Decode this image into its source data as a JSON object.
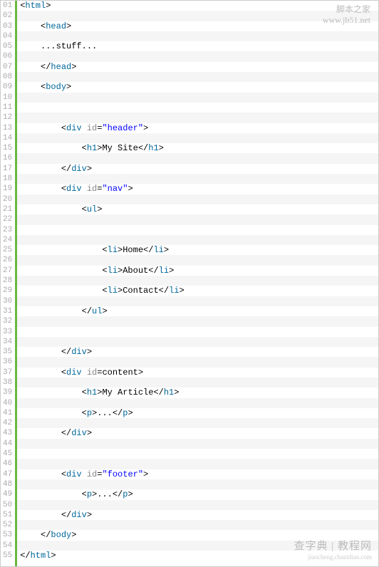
{
  "watermark_top": {
    "line1": "脚本之家",
    "line2": "www.jb51.net"
  },
  "watermark_bottom": {
    "line1": "查字典 | 教程网",
    "line2": "jiaocheng.chazidian.com"
  },
  "lines": [
    {
      "n": "01",
      "indent": 0,
      "type": "tag",
      "open": "<",
      "name": "html",
      "attrs": [],
      "close": ">"
    },
    {
      "n": "02",
      "indent": 0,
      "type": "blank"
    },
    {
      "n": "03",
      "indent": 1,
      "type": "tag",
      "open": "<",
      "name": "head",
      "attrs": [],
      "close": ">"
    },
    {
      "n": "04",
      "indent": 0,
      "type": "blank"
    },
    {
      "n": "05",
      "indent": 1,
      "type": "text",
      "text": "...stuff..."
    },
    {
      "n": "06",
      "indent": 0,
      "type": "blank"
    },
    {
      "n": "07",
      "indent": 1,
      "type": "tag",
      "open": "</",
      "name": "head",
      "attrs": [],
      "close": ">"
    },
    {
      "n": "08",
      "indent": 0,
      "type": "blank"
    },
    {
      "n": "09",
      "indent": 1,
      "type": "tag",
      "open": "<",
      "name": "body",
      "attrs": [],
      "close": ">"
    },
    {
      "n": "10",
      "indent": 0,
      "type": "blank"
    },
    {
      "n": "11",
      "indent": 0,
      "type": "blank"
    },
    {
      "n": "12",
      "indent": 0,
      "type": "blank"
    },
    {
      "n": "13",
      "indent": 2,
      "type": "tag",
      "open": "<",
      "name": "div",
      "attrs": [
        {
          "k": "id",
          "v": "\"header\"",
          "quoted": true
        }
      ],
      "close": ">"
    },
    {
      "n": "14",
      "indent": 0,
      "type": "blank"
    },
    {
      "n": "15",
      "indent": 3,
      "type": "tagtext",
      "open": "<",
      "name": "h1",
      "inner": "My Site",
      "cname": "h1"
    },
    {
      "n": "16",
      "indent": 0,
      "type": "blank"
    },
    {
      "n": "17",
      "indent": 2,
      "type": "tag",
      "open": "</",
      "name": "div",
      "attrs": [],
      "close": ">"
    },
    {
      "n": "18",
      "indent": 0,
      "type": "blank"
    },
    {
      "n": "19",
      "indent": 2,
      "type": "tag",
      "open": "<",
      "name": "div",
      "attrs": [
        {
          "k": "id",
          "v": "\"nav\"",
          "quoted": true
        }
      ],
      "close": ">"
    },
    {
      "n": "20",
      "indent": 0,
      "type": "blank"
    },
    {
      "n": "21",
      "indent": 3,
      "type": "tag",
      "open": "<",
      "name": "ul",
      "attrs": [],
      "close": ">"
    },
    {
      "n": "22",
      "indent": 0,
      "type": "blank"
    },
    {
      "n": "23",
      "indent": 0,
      "type": "blank"
    },
    {
      "n": "24",
      "indent": 0,
      "type": "blank"
    },
    {
      "n": "25",
      "indent": 4,
      "type": "tagtext",
      "open": "<",
      "name": "li",
      "inner": "Home",
      "cname": "li"
    },
    {
      "n": "26",
      "indent": 0,
      "type": "blank"
    },
    {
      "n": "27",
      "indent": 4,
      "type": "tagtext",
      "open": "<",
      "name": "li",
      "inner": "About",
      "cname": "li"
    },
    {
      "n": "28",
      "indent": 0,
      "type": "blank"
    },
    {
      "n": "29",
      "indent": 4,
      "type": "tagtext",
      "open": "<",
      "name": "li",
      "inner": "Contact",
      "cname": "li"
    },
    {
      "n": "30",
      "indent": 0,
      "type": "blank"
    },
    {
      "n": "31",
      "indent": 3,
      "type": "tag",
      "open": "</",
      "name": "ul",
      "attrs": [],
      "close": ">"
    },
    {
      "n": "32",
      "indent": 0,
      "type": "blank"
    },
    {
      "n": "33",
      "indent": 0,
      "type": "blank"
    },
    {
      "n": "34",
      "indent": 0,
      "type": "blank"
    },
    {
      "n": "35",
      "indent": 2,
      "type": "tag",
      "open": "</",
      "name": "div",
      "attrs": [],
      "close": ">"
    },
    {
      "n": "36",
      "indent": 0,
      "type": "blank"
    },
    {
      "n": "37",
      "indent": 2,
      "type": "tag",
      "open": "<",
      "name": "div",
      "attrs": [
        {
          "k": "id",
          "v": "content",
          "quoted": false
        }
      ],
      "close": ">"
    },
    {
      "n": "38",
      "indent": 0,
      "type": "blank"
    },
    {
      "n": "39",
      "indent": 3,
      "type": "tagtext",
      "open": "<",
      "name": "h1",
      "inner": "My Article",
      "cname": "h1"
    },
    {
      "n": "40",
      "indent": 0,
      "type": "blank"
    },
    {
      "n": "41",
      "indent": 3,
      "type": "tagtext",
      "open": "<",
      "name": "p",
      "inner": "...",
      "cname": "p"
    },
    {
      "n": "42",
      "indent": 0,
      "type": "blank"
    },
    {
      "n": "43",
      "indent": 2,
      "type": "tag",
      "open": "</",
      "name": "div",
      "attrs": [],
      "close": ">"
    },
    {
      "n": "44",
      "indent": 0,
      "type": "blank"
    },
    {
      "n": "45",
      "indent": 0,
      "type": "blank"
    },
    {
      "n": "46",
      "indent": 0,
      "type": "blank"
    },
    {
      "n": "47",
      "indent": 2,
      "type": "tag",
      "open": "<",
      "name": "div",
      "attrs": [
        {
          "k": "id",
          "v": "\"footer\"",
          "quoted": true
        }
      ],
      "close": ">"
    },
    {
      "n": "48",
      "indent": 0,
      "type": "blank"
    },
    {
      "n": "49",
      "indent": 3,
      "type": "tagtext",
      "open": "<",
      "name": "p",
      "inner": "...",
      "cname": "p"
    },
    {
      "n": "50",
      "indent": 0,
      "type": "blank"
    },
    {
      "n": "51",
      "indent": 2,
      "type": "tag",
      "open": "</",
      "name": "div",
      "attrs": [],
      "close": ">"
    },
    {
      "n": "52",
      "indent": 0,
      "type": "blank"
    },
    {
      "n": "53",
      "indent": 1,
      "type": "tag",
      "open": "</",
      "name": "body",
      "attrs": [],
      "close": ">"
    },
    {
      "n": "54",
      "indent": 0,
      "type": "blank"
    },
    {
      "n": "55",
      "indent": 0,
      "type": "tag",
      "open": "</",
      "name": "html",
      "attrs": [],
      "close": ">"
    }
  ]
}
